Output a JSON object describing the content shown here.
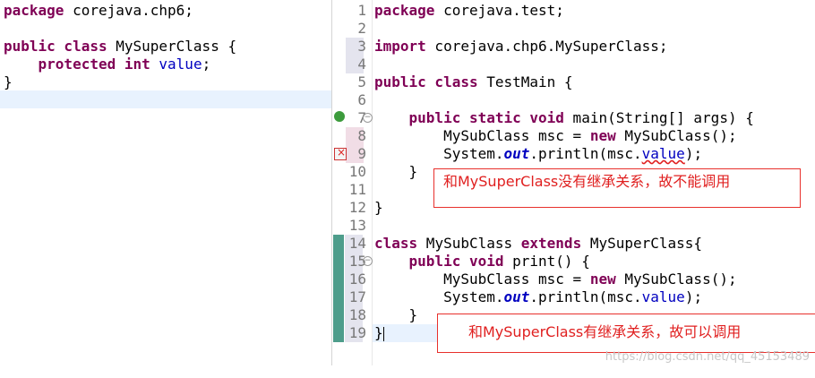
{
  "left_editor": {
    "lines": [
      [
        "package corejava.chp6;"
      ],
      [
        ""
      ],
      [
        "public class MySuperClass {"
      ],
      [
        "    protected int value;"
      ],
      [
        "}"
      ]
    ]
  },
  "right_editor": {
    "line_numbers": [
      "1",
      "2",
      "3",
      "4",
      "5",
      "6",
      "7",
      "8",
      "9",
      "10",
      "11",
      "12",
      "13",
      "14",
      "15",
      "16",
      "17",
      "18",
      "19"
    ],
    "lines": {
      "l1": "package corejava.test;",
      "l3a": "import",
      "l3b": " corejava.chp6.MySuperClass;",
      "l5a": "public class",
      "l5b": " TestMain {",
      "l7a": "    public static void",
      "l7b": " main(String[] args) {",
      "l8a": "        MySubClass msc = ",
      "l8b": "new",
      "l8c": " MySubClass();",
      "l9a": "        System.",
      "l9b": "out",
      "l9c": ".println(msc.",
      "l9d": "value",
      "l9e": ");",
      "l10": "    }",
      "l12": "}",
      "l14a": "class",
      "l14b": " MySubClass ",
      "l14c": "extends",
      "l14d": " MySuperClass{",
      "l15a": "    public void",
      "l15b": " print() {",
      "l16a": "        MySubClass msc = ",
      "l16b": "new",
      "l16c": " MySubClass();",
      "l17a": "        System.",
      "l17b": "out",
      "l17c": ".println(msc.",
      "l17d": "value",
      "l17e": ");",
      "l18": "    }",
      "l19": "}"
    }
  },
  "annotations": {
    "no_inherit": "和MySuperClass没有继承关系，故不能调用",
    "inherit": "和MySuperClass有继承关系，故可以调用"
  },
  "watermark": "https://blog.csdn.net/qq_45153489",
  "colors": {
    "keyword": "#7f0055",
    "field": "#0000c0",
    "annotation": "#e02020"
  }
}
